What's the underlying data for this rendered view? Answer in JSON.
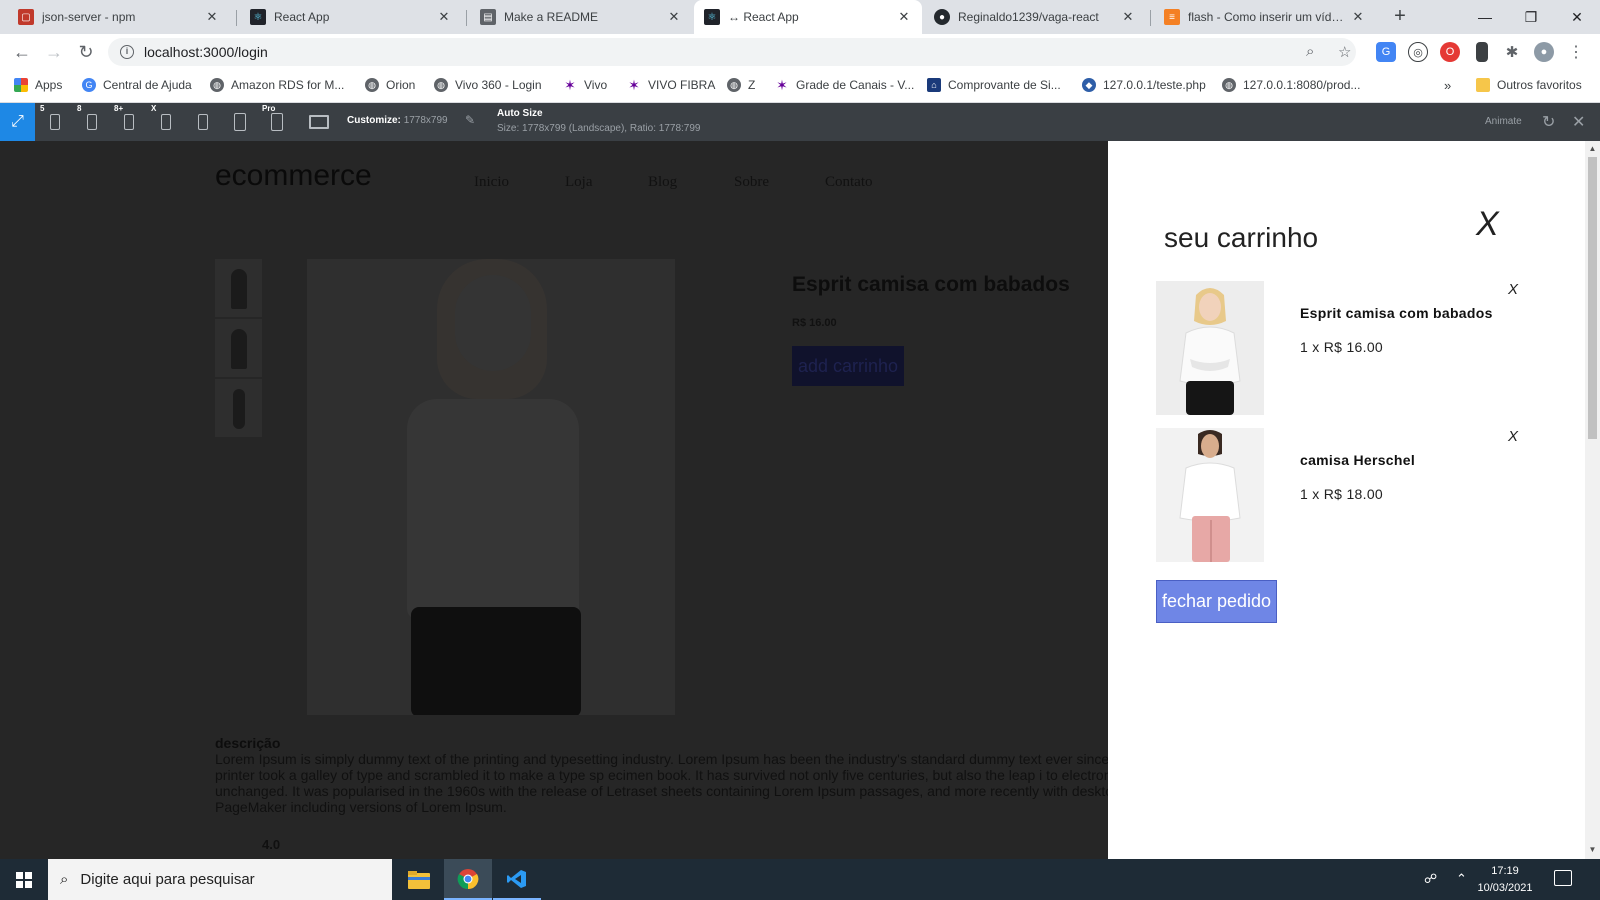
{
  "browser": {
    "tabs": [
      {
        "title": "json-server - npm",
        "favicon_color": "#c0392b",
        "active": false
      },
      {
        "title": "React App",
        "favicon_color": "#20232a",
        "active": false
      },
      {
        "title": "Make a README",
        "favicon_color": "#5f6368",
        "active": false
      },
      {
        "title": "↔ React App",
        "favicon_color": "#20232a",
        "active": true
      },
      {
        "title": "Reginaldo1239/vaga-react",
        "favicon_color": "#24292e",
        "active": false
      },
      {
        "title": "flash - Como inserir um vídeo n",
        "favicon_color": "#f48024",
        "active": false
      }
    ],
    "new_tab_icon": "plus-icon",
    "url": "localhost:3000/login",
    "bookmarks": [
      {
        "label": "Apps",
        "icon": "apps-grid-icon",
        "color": "#ea4335"
      },
      {
        "label": "Central de Ajuda",
        "icon": "google-icon",
        "color": "#4285f4"
      },
      {
        "label": "Amazon RDS for M...",
        "icon": "globe-icon",
        "color": "#5f6368"
      },
      {
        "label": "Orion",
        "icon": "globe-icon",
        "color": "#5f6368"
      },
      {
        "label": "Vivo 360 - Login",
        "icon": "globe-icon",
        "color": "#5f6368"
      },
      {
        "label": "Vivo",
        "icon": "vivo-icon",
        "color": "#660099"
      },
      {
        "label": "VIVO FIBRA",
        "icon": "vivo-icon",
        "color": "#660099"
      },
      {
        "label": "Z",
        "icon": "globe-icon",
        "color": "#5f6368"
      },
      {
        "label": "Grade de Canais - V...",
        "icon": "vivo-icon",
        "color": "#660099"
      },
      {
        "label": "Comprovante de Si...",
        "icon": "bank-icon",
        "color": "#1a3a7a"
      },
      {
        "label": "127.0.0.1/teste.php",
        "icon": "php-icon",
        "color": "#2e5ea8"
      },
      {
        "label": "127.0.0.1:8080/prod...",
        "icon": "globe-icon",
        "color": "#5f6368"
      },
      {
        "label": "Outros favoritos",
        "icon": "folder-icon",
        "color": "#f6c64a"
      }
    ]
  },
  "responsive_viewer": {
    "device_badges": [
      "5",
      "8",
      "8+",
      "X",
      "",
      "",
      "Pro",
      ""
    ],
    "customize_label": "Customize:",
    "customize_value": "1778x799",
    "auto_size_label": "Auto Size",
    "size_info": "Size: 1778x799 (Landscape), Ratio: 1778:799",
    "animate_label": "Animate"
  },
  "page": {
    "brand": "ecommerce",
    "nav": [
      "Inicio",
      "Loja",
      "Blog",
      "Sobre",
      "Contato"
    ],
    "product_title": "Esprit camisa com babados",
    "product_price": "R$ 16.00",
    "add_button": "add carrinho",
    "description_heading": "descrição",
    "description_lines": [
      "Lorem Ipsum is simply dummy text of the printing and typesetting industry. Lorem Ipsum has been the industry's standard dummy text ever since the 1500s, when an unknown",
      "printer took a galley of type and scrambled it to make a type sp ecimen book. It has survived not only five centuries, but also the leap i to electronic typesetting, remaining essentially",
      "unchanged. It was popularised in the 1960s with the release of Letraset sheets containing Lorem Ipsum passages, and more recently with desktop publishing software like Aldus",
      "PageMaker including versions of Lorem Ipsum."
    ],
    "rating": "4.0"
  },
  "cart": {
    "title": "seu carrinho",
    "close_label": "X",
    "items": [
      {
        "name": "Esprit camisa com babados",
        "qty_price": "1 x R$ 16.00",
        "remove_label": "X"
      },
      {
        "name": "camisa Herschel",
        "qty_price": "1 x R$ 18.00",
        "remove_label": "X"
      }
    ],
    "checkout_label": "fechar pedido"
  },
  "taskbar": {
    "search_placeholder": "Digite aqui para pesquisar",
    "time": "17:19",
    "date": "10/03/2021"
  }
}
